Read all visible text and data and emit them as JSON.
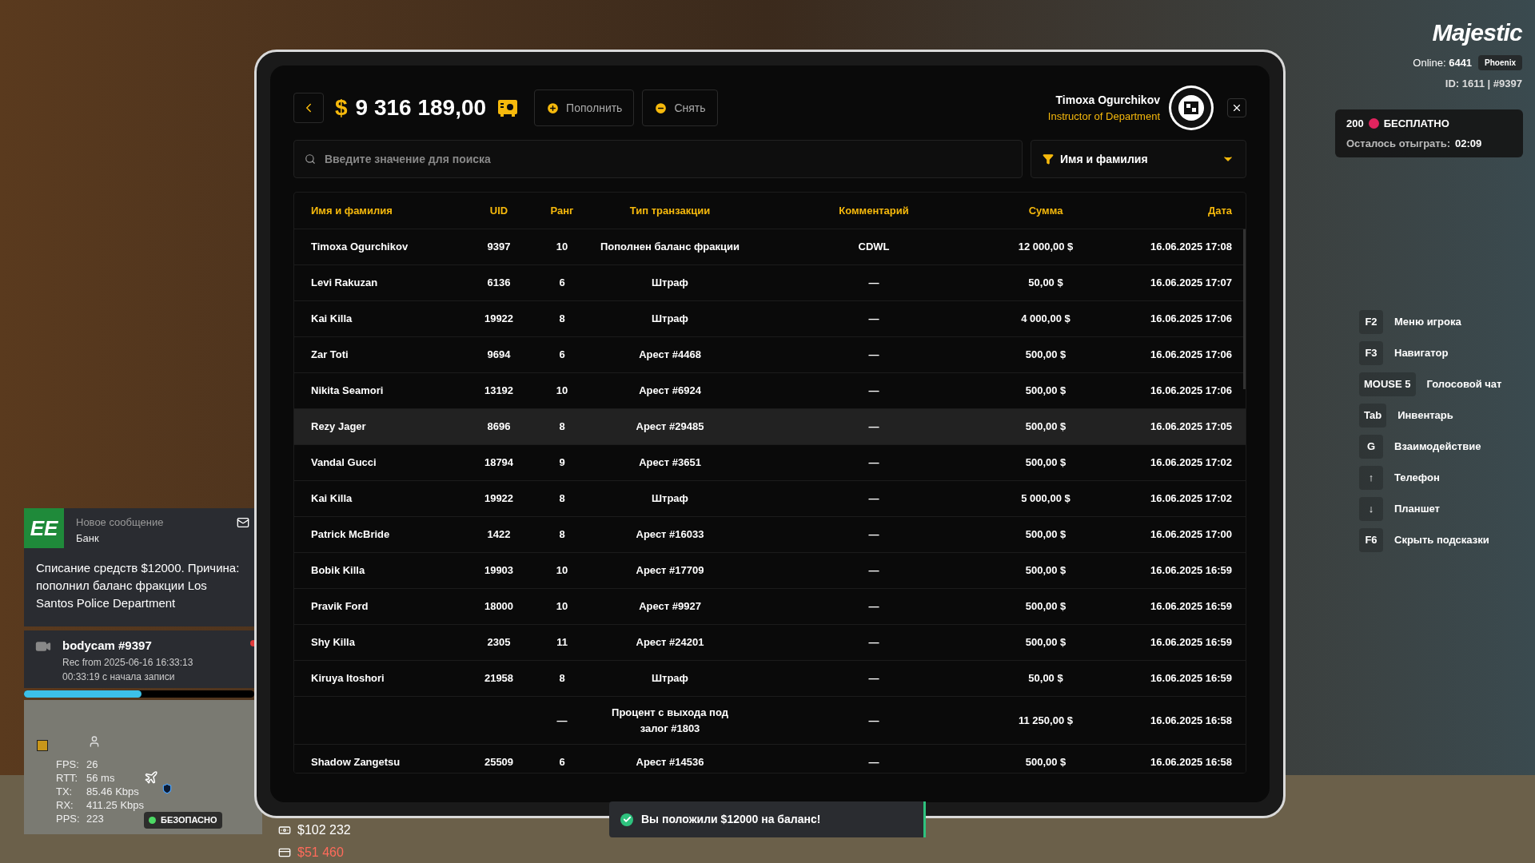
{
  "hud": {
    "logo": "Majestic",
    "online_label": "Online:",
    "online_count": "6441",
    "server": "Phoenix",
    "player_id": "ID: 1611 | #9397"
  },
  "bonus": {
    "amount": "200",
    "label": "БЕСПЛАТНО",
    "remaining_label": "Осталось отыграть:",
    "remaining_time": "02:09"
  },
  "hints": [
    {
      "key": "F2",
      "label": "Меню игрока"
    },
    {
      "key": "F3",
      "label": "Навигатор"
    },
    {
      "key": "MOUSE 5",
      "label": "Голосовой чат"
    },
    {
      "key": "Tab",
      "label": "Инвентарь"
    },
    {
      "key": "G",
      "label": "Взаимодействие"
    },
    {
      "key": "↑",
      "label": "Телефон"
    },
    {
      "key": "↓",
      "label": "Планшет"
    },
    {
      "key": "F6",
      "label": "Скрыть подсказки"
    }
  ],
  "notification": {
    "icon_text": "EE",
    "title": "Новое сообщение",
    "sender": "Банк",
    "message": "Списание средств $12000. Причина: пополнил баланс фракции Los Santos Police Department"
  },
  "bodycam": {
    "title": "bodycam #9397",
    "recorded": "Rec from 2025-06-16 16:33:13",
    "elapsed": "00:33:19 с начала записи",
    "level": 0.51
  },
  "netstats": [
    {
      "label": "FPS:",
      "value": "26"
    },
    {
      "label": "RTT:",
      "value": "56 ms"
    },
    {
      "label": "TX:",
      "value": "85.46 Kbps"
    },
    {
      "label": "RX:",
      "value": "411.25 Kbps"
    },
    {
      "label": "PPS:",
      "value": "223"
    }
  ],
  "zone_status": "БЕЗОПАСНО",
  "wallet": {
    "cash": "$102 232",
    "bank": "$51 460"
  },
  "tablet": {
    "currency": "$",
    "balance": "9 316 189,00",
    "deposit_button": "Пополнить",
    "withdraw_button": "Снять",
    "user_name": "Timoxa Ogurchikov",
    "user_role": "Instructor of Department",
    "search": {
      "placeholder": "Введите значение для поиска"
    },
    "filter": "Имя и фамилия",
    "table": {
      "columns": [
        "Имя и фамилия",
        "UID",
        "Ранг",
        "Тип транзакции",
        "Комментарий",
        "Сумма",
        "Дата"
      ],
      "rows": [
        {
          "name": "Timoxa Ogurchikov",
          "uid": "9397",
          "rank": "10",
          "type": "Пополнен баланс фракции",
          "comment": "CDWL",
          "sum": "12 000,00 $",
          "date": "16.06.2025 17:08",
          "selected": false
        },
        {
          "name": "Levi Rakuzan",
          "uid": "6136",
          "rank": "6",
          "type": "Штраф",
          "comment": "—",
          "sum": "50,00 $",
          "date": "16.06.2025 17:07",
          "selected": false
        },
        {
          "name": "Kai Killa",
          "uid": "19922",
          "rank": "8",
          "type": "Штраф",
          "comment": "—",
          "sum": "4 000,00 $",
          "date": "16.06.2025 17:06",
          "selected": false
        },
        {
          "name": "Zar Toti",
          "uid": "9694",
          "rank": "6",
          "type": "Арест #4468",
          "comment": "—",
          "sum": "500,00 $",
          "date": "16.06.2025 17:06",
          "selected": false
        },
        {
          "name": "Nikita Seamori",
          "uid": "13192",
          "rank": "10",
          "type": "Арест #6924",
          "comment": "—",
          "sum": "500,00 $",
          "date": "16.06.2025 17:06",
          "selected": false
        },
        {
          "name": "Rezy Jager",
          "uid": "8696",
          "rank": "8",
          "type": "Арест #29485",
          "comment": "—",
          "sum": "500,00 $",
          "date": "16.06.2025 17:05",
          "selected": true
        },
        {
          "name": "Vandal Gucci",
          "uid": "18794",
          "rank": "9",
          "type": "Арест #3651",
          "comment": "—",
          "sum": "500,00 $",
          "date": "16.06.2025 17:02",
          "selected": false
        },
        {
          "name": "Kai Killa",
          "uid": "19922",
          "rank": "8",
          "type": "Штраф",
          "comment": "—",
          "sum": "5 000,00 $",
          "date": "16.06.2025 17:02",
          "selected": false
        },
        {
          "name": "Patrick McBride",
          "uid": "1422",
          "rank": "8",
          "type": "Арест #16033",
          "comment": "—",
          "sum": "500,00 $",
          "date": "16.06.2025 17:00",
          "selected": false
        },
        {
          "name": "Bobik Killa",
          "uid": "19903",
          "rank": "10",
          "type": "Арест #17709",
          "comment": "—",
          "sum": "500,00 $",
          "date": "16.06.2025 16:59",
          "selected": false
        },
        {
          "name": "Pravik Ford",
          "uid": "18000",
          "rank": "10",
          "type": "Арест #9927",
          "comment": "—",
          "sum": "500,00 $",
          "date": "16.06.2025 16:59",
          "selected": false
        },
        {
          "name": "Shy Killa",
          "uid": "2305",
          "rank": "11",
          "type": "Арест #24201",
          "comment": "—",
          "sum": "500,00 $",
          "date": "16.06.2025 16:59",
          "selected": false
        },
        {
          "name": "Kiruya Itoshori",
          "uid": "21958",
          "rank": "8",
          "type": "Штраф",
          "comment": "—",
          "sum": "50,00 $",
          "date": "16.06.2025 16:59",
          "selected": false
        },
        {
          "rank": "—",
          "type": "Процент с выхода под залог #1803",
          "comment": "—",
          "sum": "11 250,00 $",
          "date": "16.06.2025 16:58",
          "selected": false
        },
        {
          "name": "Shadow Zangetsu",
          "uid": "25509",
          "rank": "6",
          "type": "Арест #14536",
          "comment": "—",
          "sum": "500,00 $",
          "date": "16.06.2025 16:58",
          "selected": false
        }
      ]
    }
  },
  "toast": "Вы положили $12000 на баланс!"
}
